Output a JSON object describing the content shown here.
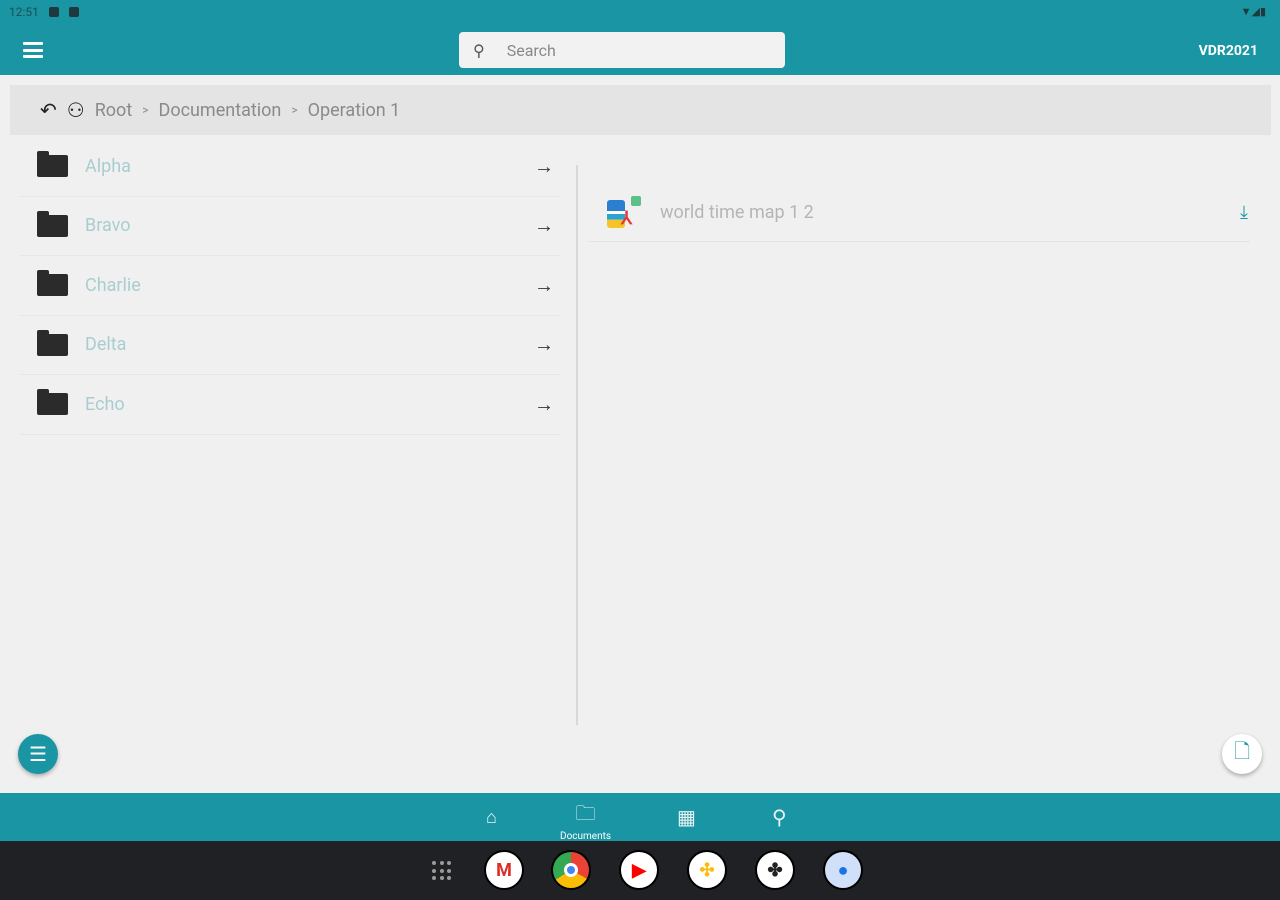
{
  "status": {
    "time": "12:51"
  },
  "header": {
    "search_placeholder": "Search",
    "brand": "VDR2021"
  },
  "breadcrumb": {
    "items": [
      "Root",
      "Documentation",
      "Operation 1"
    ],
    "separator": ">"
  },
  "folders": [
    {
      "name": "Alpha"
    },
    {
      "name": "Bravo"
    },
    {
      "name": "Charlie"
    },
    {
      "name": "Delta"
    },
    {
      "name": "Echo"
    }
  ],
  "files": [
    {
      "name": "world time map 1 2"
    }
  ],
  "bottom_nav": {
    "items": [
      {
        "icon": "home-icon"
      },
      {
        "icon": "folder-icon",
        "label": "Documents"
      },
      {
        "icon": "calendar-icon"
      },
      {
        "icon": "search-icon"
      }
    ]
  },
  "dock": [
    "gmail",
    "chrome",
    "youtube",
    "photos",
    "app",
    "messages"
  ],
  "colors": {
    "accent": "#1a95a3"
  }
}
